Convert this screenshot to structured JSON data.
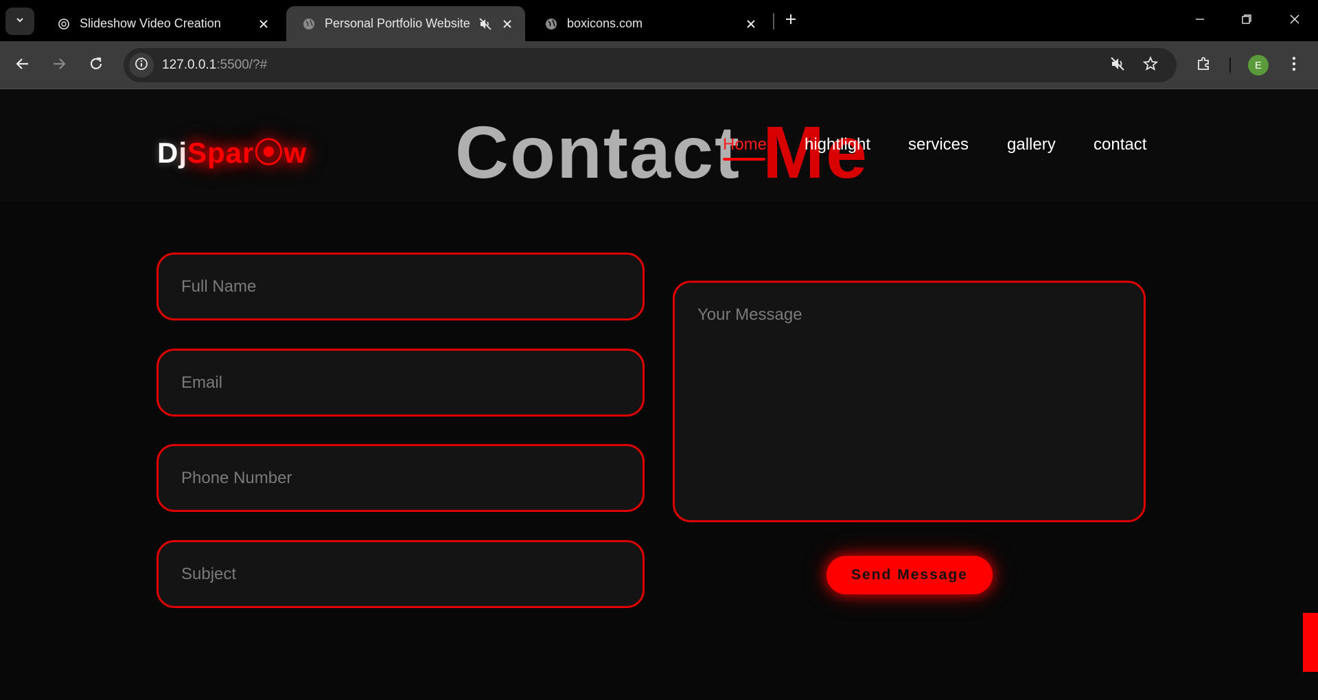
{
  "browser": {
    "tabs": [
      {
        "title": "Slideshow Video Creation",
        "favicon": "openai-icon",
        "active": false
      },
      {
        "title": "Personal Portfolio Website",
        "favicon": "globe-icon",
        "active": true,
        "muted": true
      },
      {
        "title": "boxicons.com",
        "favicon": "globe-icon",
        "active": false
      }
    ],
    "url_host": "127.0.0.1",
    "url_rest": ":5500/?#",
    "profile_initial": "E",
    "colors": {
      "accent": "#ff0000",
      "chrome": "#3c3c3c",
      "profile": "#5a9a3a"
    }
  },
  "site": {
    "logo_dj": "Dj",
    "logo_sparrow": "Spar⦿w",
    "heading_part1": "Contact ",
    "heading_part2": "Me",
    "nav": [
      "Home",
      "hightlight",
      "services",
      "gallery",
      "contact"
    ],
    "form": {
      "full_name_placeholder": "Full Name",
      "email_placeholder": "Email",
      "phone_placeholder": "Phone Number",
      "subject_placeholder": "Subject",
      "message_placeholder": "Your Message",
      "send_label": "Send Message"
    }
  }
}
